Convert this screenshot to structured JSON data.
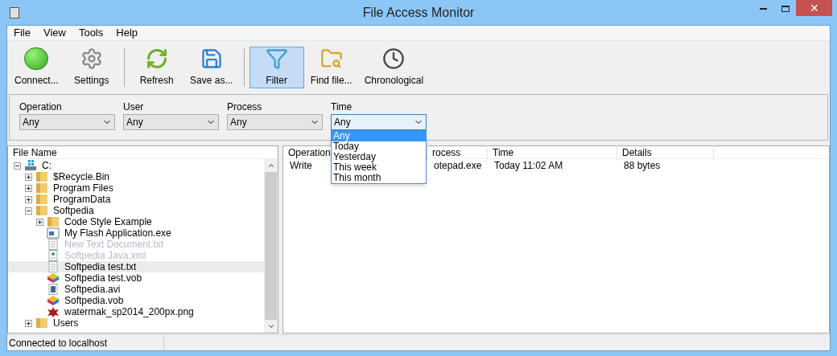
{
  "window": {
    "title": "File Access Monitor"
  },
  "menu": [
    "File",
    "View",
    "Tools",
    "Help"
  ],
  "window_buttons": {
    "close": "✕"
  },
  "toolbar": [
    [
      {
        "label": "Connect...",
        "kind": "connect",
        "selected": false
      },
      {
        "label": "Settings",
        "kind": "settings",
        "selected": false
      }
    ],
    [
      {
        "label": "Refresh",
        "kind": "refresh",
        "selected": false
      },
      {
        "label": "Save as...",
        "kind": "save",
        "selected": false
      }
    ],
    [
      {
        "label": "Filter",
        "kind": "filter",
        "selected": true
      },
      {
        "label": "Find file...",
        "kind": "find",
        "selected": false
      },
      {
        "label": "Chronological",
        "kind": "clock",
        "selected": false
      }
    ]
  ],
  "filters": [
    {
      "label": "Operation",
      "value": "Any",
      "open": false
    },
    {
      "label": "User",
      "value": "Any",
      "open": false
    },
    {
      "label": "Process",
      "value": "Any",
      "open": false
    },
    {
      "label": "Time",
      "value": "Any",
      "open": true,
      "options": [
        {
          "label": "Any",
          "selected": true
        },
        {
          "label": "Today",
          "selected": false
        },
        {
          "label": "Yesterday",
          "selected": false
        },
        {
          "label": "This week",
          "selected": false
        },
        {
          "label": "This month",
          "selected": false
        }
      ]
    }
  ],
  "tree": {
    "column": "File Name",
    "items": [
      {
        "name": "C:",
        "kind": "drive",
        "expanded": true,
        "dimmed": false,
        "selected": false,
        "children": [
          {
            "name": "$Recycle.Bin",
            "kind": "folder",
            "expanded": false,
            "dimmed": false,
            "selected": false
          },
          {
            "name": "Program Files",
            "kind": "folder",
            "expanded": false,
            "dimmed": false,
            "selected": false
          },
          {
            "name": "ProgramData",
            "kind": "folder",
            "expanded": false,
            "dimmed": false,
            "selected": false
          },
          {
            "name": "Softpedia",
            "kind": "folder",
            "expanded": true,
            "dimmed": false,
            "selected": false,
            "children": [
              {
                "name": "Code Style Example",
                "kind": "folder",
                "expanded": false,
                "dimmed": false,
                "selected": false
              },
              {
                "name": "My Flash Application.exe",
                "kind": "exe",
                "dimmed": false,
                "selected": false
              },
              {
                "name": "New Text Document.txt",
                "kind": "txt",
                "dimmed": true,
                "selected": false
              },
              {
                "name": "Softpedia Java.xml",
                "kind": "xml",
                "dimmed": true,
                "selected": false
              },
              {
                "name": "Softpedia test.txt",
                "kind": "txt",
                "dimmed": false,
                "selected": true
              },
              {
                "name": "Softpedia test.vob",
                "kind": "vob",
                "dimmed": false,
                "selected": false
              },
              {
                "name": "Softpedia.avi",
                "kind": "avi",
                "dimmed": false,
                "selected": false
              },
              {
                "name": "Softpedia.vob",
                "kind": "vob",
                "dimmed": false,
                "selected": false
              },
              {
                "name": "watermak_sp2014_200px.png",
                "kind": "png",
                "dimmed": false,
                "selected": false
              }
            ]
          },
          {
            "name": "Users",
            "kind": "folder",
            "expanded": false,
            "dimmed": false,
            "selected": false
          }
        ]
      }
    ]
  },
  "table": {
    "columns": [
      "Operation",
      "rocess",
      "Time",
      "Details"
    ],
    "rows": [
      [
        "Write",
        "otepad.exe",
        "Today 11:02 AM",
        "88 bytes"
      ]
    ]
  },
  "status_bar": "Connected to localhost"
}
